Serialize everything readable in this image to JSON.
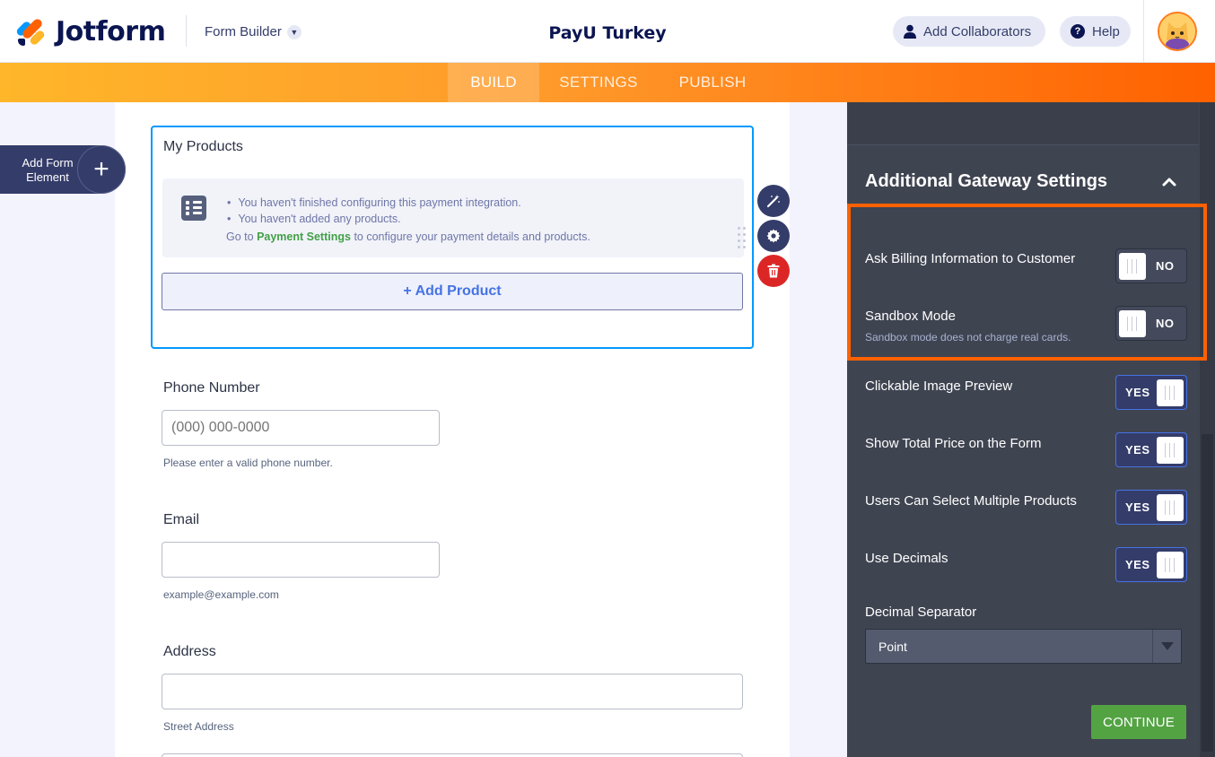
{
  "header": {
    "logo_text": "Jotform",
    "builder_label": "Form Builder",
    "form_title": "PayU Turkey",
    "collaborators_label": "Add Collaborators",
    "help_label": "Help"
  },
  "tabs": {
    "build": "BUILD",
    "settings": "SETTINGS",
    "publish": "PUBLISH",
    "active": "BUILD"
  },
  "sidebar": {
    "add_element_label": "Add Form Element"
  },
  "form": {
    "products": {
      "title": "My Products",
      "notices": [
        "You haven't finished configuring this payment integration.",
        "You haven't added any products."
      ],
      "foot_prefix": "Go to",
      "foot_link": "Payment Settings",
      "foot_suffix": "to configure your payment details and products.",
      "add_product_label": "+ Add Product"
    },
    "phone": {
      "label": "Phone Number",
      "placeholder": "(000) 000-0000",
      "hint": "Please enter a valid phone number."
    },
    "email": {
      "label": "Email",
      "value": "",
      "hint": "example@example.com"
    },
    "address": {
      "label": "Address",
      "value": "",
      "hint": "Street Address"
    }
  },
  "panel": {
    "title": "Additional Gateway Settings",
    "settings": [
      {
        "label": "Ask Billing Information to Customer",
        "state": "NO"
      },
      {
        "label": "Sandbox Mode",
        "sub": "Sandbox mode does not charge real cards.",
        "state": "NO"
      },
      {
        "label": "Clickable Image Preview",
        "state": "YES"
      },
      {
        "label": "Show Total Price on the Form",
        "state": "YES"
      },
      {
        "label": "Users Can Select Multiple Products",
        "state": "YES"
      },
      {
        "label": "Use Decimals",
        "state": "YES"
      }
    ],
    "decimal_separator_label": "Decimal Separator",
    "decimal_separator_value": "Point",
    "continue_label": "CONTINUE"
  },
  "colors": {
    "brand_orange": "#ff6100",
    "accent_blue": "#0099ff",
    "continue_green": "#53a343",
    "danger_red": "#dc2626"
  }
}
